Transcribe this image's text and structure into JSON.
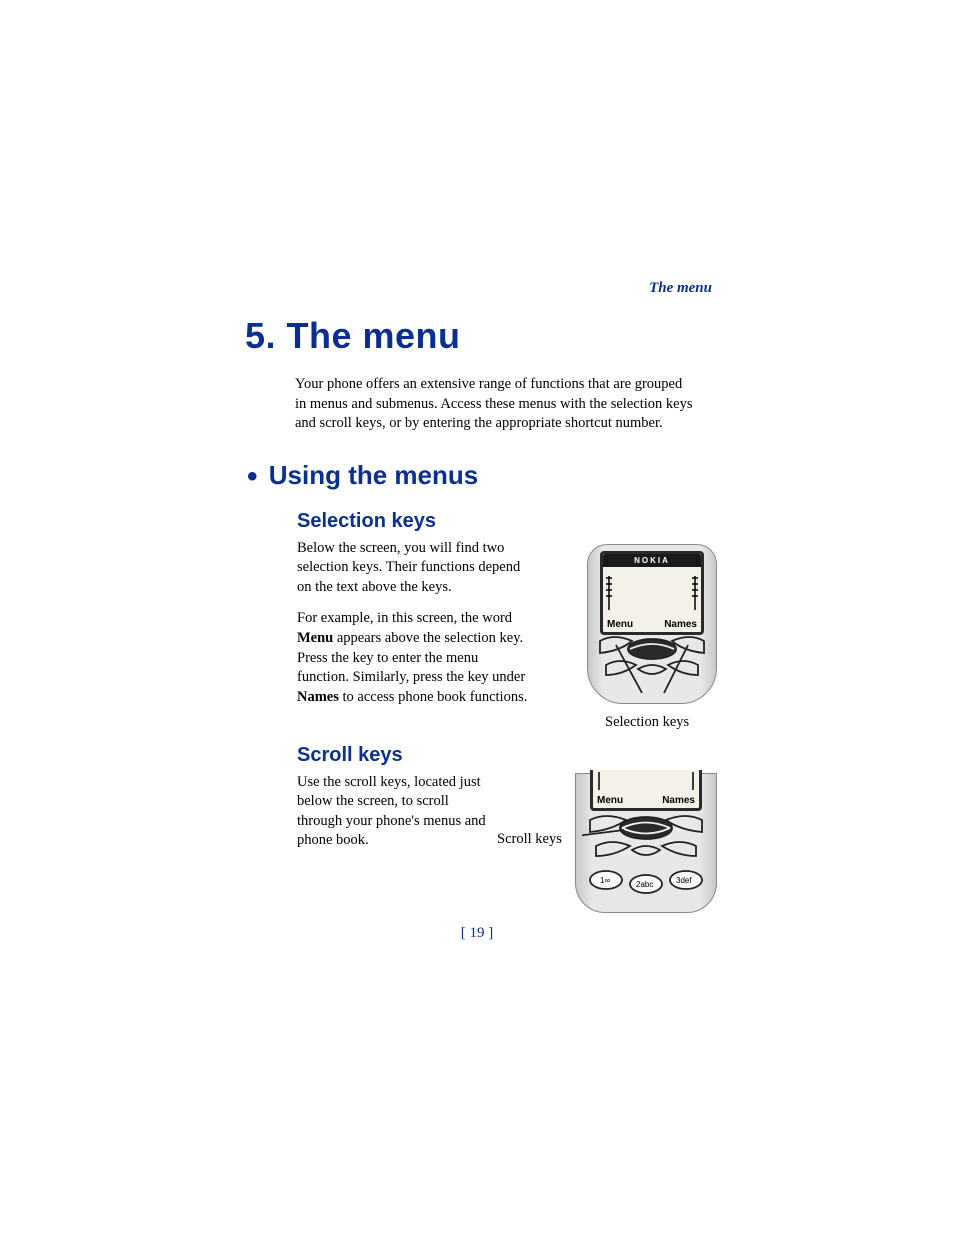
{
  "running_head": "The menu",
  "chapter_title": "5.  The menu",
  "intro": "Your phone offers an extensive range of functions that are grouped in menus and submenus. Access these menus with the selection keys and scroll keys, or by entering the appropriate shortcut number.",
  "section_using": "Using the menus",
  "sel": {
    "heading": "Selection keys",
    "p1": "Below the screen, you will find two selection keys. Their functions depend on the text above the keys.",
    "p2a": "For example, in this screen, the word ",
    "p2_bold1": "Menu",
    "p2b": " appears above the selection key. Press the key to enter the menu function. Similarly, press the key under ",
    "p2_bold2": "Names",
    "p2c": " to access phone book functions.",
    "caption": "Selection keys"
  },
  "scroll": {
    "heading": "Scroll keys",
    "p1": "Use the scroll keys, located just below the screen, to scroll through your phone's menus and phone book.",
    "caption": "Scroll keys"
  },
  "phone": {
    "brand": "NOKIA",
    "soft_left": "Menu",
    "soft_right": "Names",
    "keys": {
      "k1": "1",
      "k2": "2abc",
      "k3": "3def"
    }
  },
  "page_number": "[ 19 ]"
}
